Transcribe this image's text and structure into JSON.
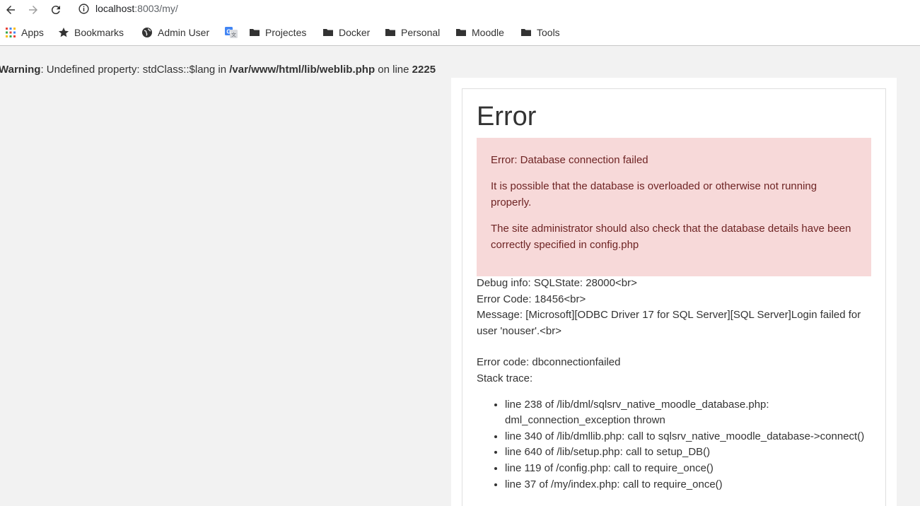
{
  "browser": {
    "url_host": "localhost",
    "url_rest": ":8003/my/"
  },
  "bookmarks": [
    {
      "label": "Apps",
      "icon": "apps-grid-icon"
    },
    {
      "label": "Bookmarks",
      "icon": "star-icon"
    },
    {
      "label": "Admin User",
      "icon": "globe-icon"
    },
    {
      "label": "",
      "icon": "google-translate-icon"
    },
    {
      "label": "Projectes",
      "icon": "folder-icon"
    },
    {
      "label": "Docker",
      "icon": "folder-icon"
    },
    {
      "label": "Personal",
      "icon": "folder-icon"
    },
    {
      "label": "Moodle",
      "icon": "folder-icon"
    },
    {
      "label": "Tools",
      "icon": "folder-icon"
    }
  ],
  "warning": {
    "label": "Warning",
    "text": ": Undefined property: stdClass::$lang in ",
    "file": "/var/www/html/lib/weblib.php",
    "on_line": " on line ",
    "line": "2225"
  },
  "error": {
    "title": "Error",
    "alert": [
      "Error: Database connection failed",
      "It is possible that the database is overloaded or otherwise not running properly.",
      "The site administrator should also check that the database details have been correctly specified in config.php"
    ],
    "debug_lines": [
      "Debug info: SQLState: 28000<br>",
      "Error Code: 18456<br>",
      "Message: [Microsoft][ODBC Driver 17 for SQL Server][SQL Server]Login failed for user 'nouser'.<br>"
    ],
    "error_code": "Error code: dbconnectionfailed",
    "stack_label": "Stack trace:",
    "stack": [
      "line 238 of /lib/dml/sqlsrv_native_moodle_database.php: dml_connection_exception thrown",
      "line 340 of /lib/dmllib.php: call to sqlsrv_native_moodle_database->connect()",
      "line 640 of /lib/setup.php: call to setup_DB()",
      "line 119 of /config.php: call to require_once()",
      "line 37 of /my/index.php: call to require_once()"
    ]
  },
  "colors": {
    "alert_bg": "#f7d9d9",
    "alert_text": "#6e2424",
    "page_bg": "#f2f2f2"
  }
}
